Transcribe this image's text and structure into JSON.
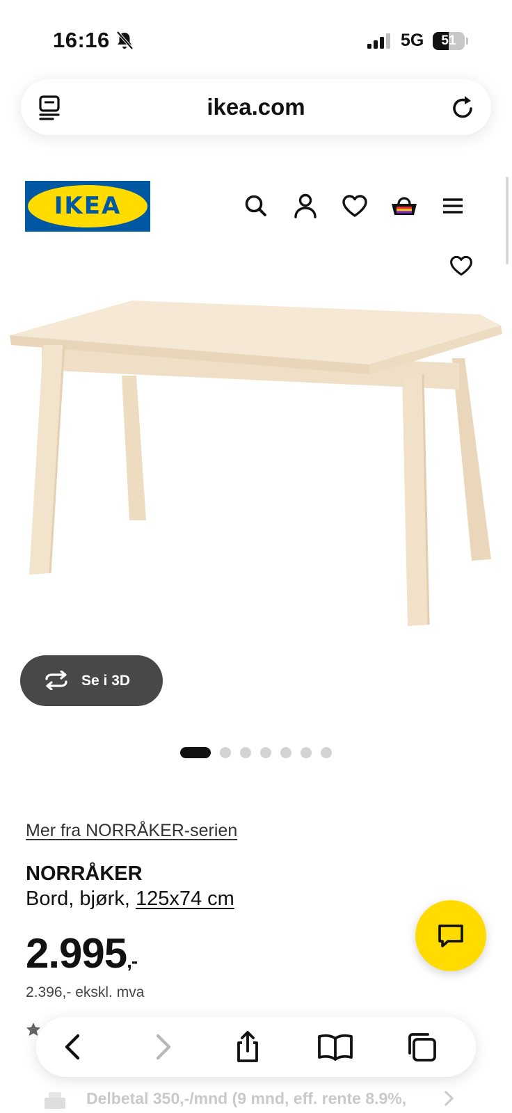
{
  "status_bar": {
    "time": "16:16",
    "network": "5G",
    "battery_level": "51",
    "icons": [
      "bell-slash-icon",
      "signal-icon",
      "battery-icon"
    ]
  },
  "browser": {
    "url": "ikea.com",
    "icons": [
      "reader-icon",
      "reload-icon"
    ]
  },
  "header": {
    "logo_text": "IKEA",
    "icons": [
      "search-icon",
      "user-icon",
      "heart-icon",
      "basket-icon",
      "menu-icon"
    ]
  },
  "gallery": {
    "view_3d_label": "Se i 3D",
    "image_count": 7,
    "active_index": 0
  },
  "product": {
    "series_link": "Mer fra NORRÅKER-serien",
    "name": "NORRÅKER",
    "description": "Bord, bjørk, ",
    "size": "125x74 cm",
    "price_main": "2.995",
    "price_suffix": ",-",
    "price_ex_vat": "2.396,- ekskl. mva",
    "finance_text": "Delbetal 350,-/mnd (9 mnd, eff. rente 8.9%,"
  },
  "toolbar": {
    "icons": [
      "back-icon",
      "forward-icon",
      "share-icon",
      "bookmarks-icon",
      "tabs-icon"
    ]
  },
  "colors": {
    "ikea_blue": "#0058a3",
    "ikea_yellow": "#ffdb00",
    "dark_button": "#484848",
    "wood": "#f2e4cd"
  }
}
